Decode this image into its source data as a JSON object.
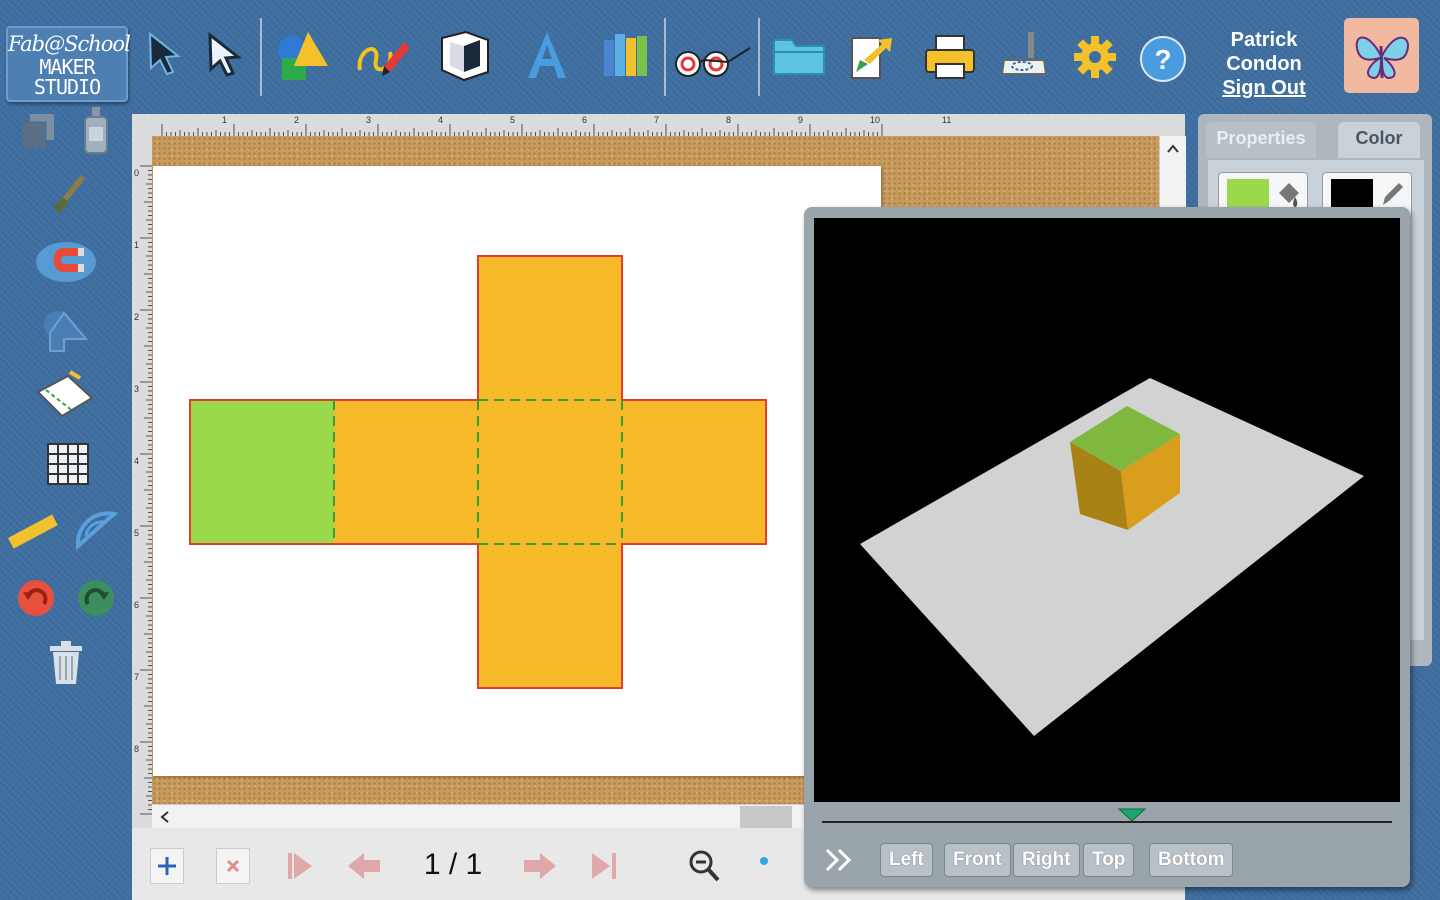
{
  "logo": {
    "line1": "Fab@School",
    "line2": "MAKER STUDIO"
  },
  "toolbar": {
    "tools": [
      "select-arrow",
      "direct-select-arrow",
      "shapes",
      "freehand-pen",
      "3d-object",
      "text",
      "library",
      "3d-glasses",
      "open-folder",
      "import-export",
      "print",
      "cut-machine",
      "settings",
      "help"
    ]
  },
  "user": {
    "first_name": "Patrick",
    "last_name": "Condon",
    "sign_out": "Sign Out"
  },
  "ruler": {
    "top_numbers": [
      "1",
      "2",
      "3",
      "4",
      "5",
      "6",
      "7",
      "8",
      "9",
      "10",
      "11"
    ],
    "left_numbers": [
      "0",
      "1",
      "2",
      "3",
      "4",
      "5",
      "6",
      "7",
      "8"
    ]
  },
  "pager": {
    "page_display": "1 / 1"
  },
  "panel": {
    "tab_properties": "Properties",
    "tab_color": "Color",
    "fill_color": "#9ad94c",
    "stroke_color": "#000000"
  },
  "design": {
    "face_color": "#f5b929",
    "accent_face_color": "#9ad94c",
    "outline_color": "#e43b2b",
    "fold_line_color": "#3aa02a"
  },
  "viewer3d": {
    "view_buttons": {
      "left": "Left",
      "front": "Front",
      "right": "Right",
      "top": "Top",
      "bottom": "Bottom"
    },
    "plane_color": "#d2d2d2",
    "background": "#000000"
  }
}
